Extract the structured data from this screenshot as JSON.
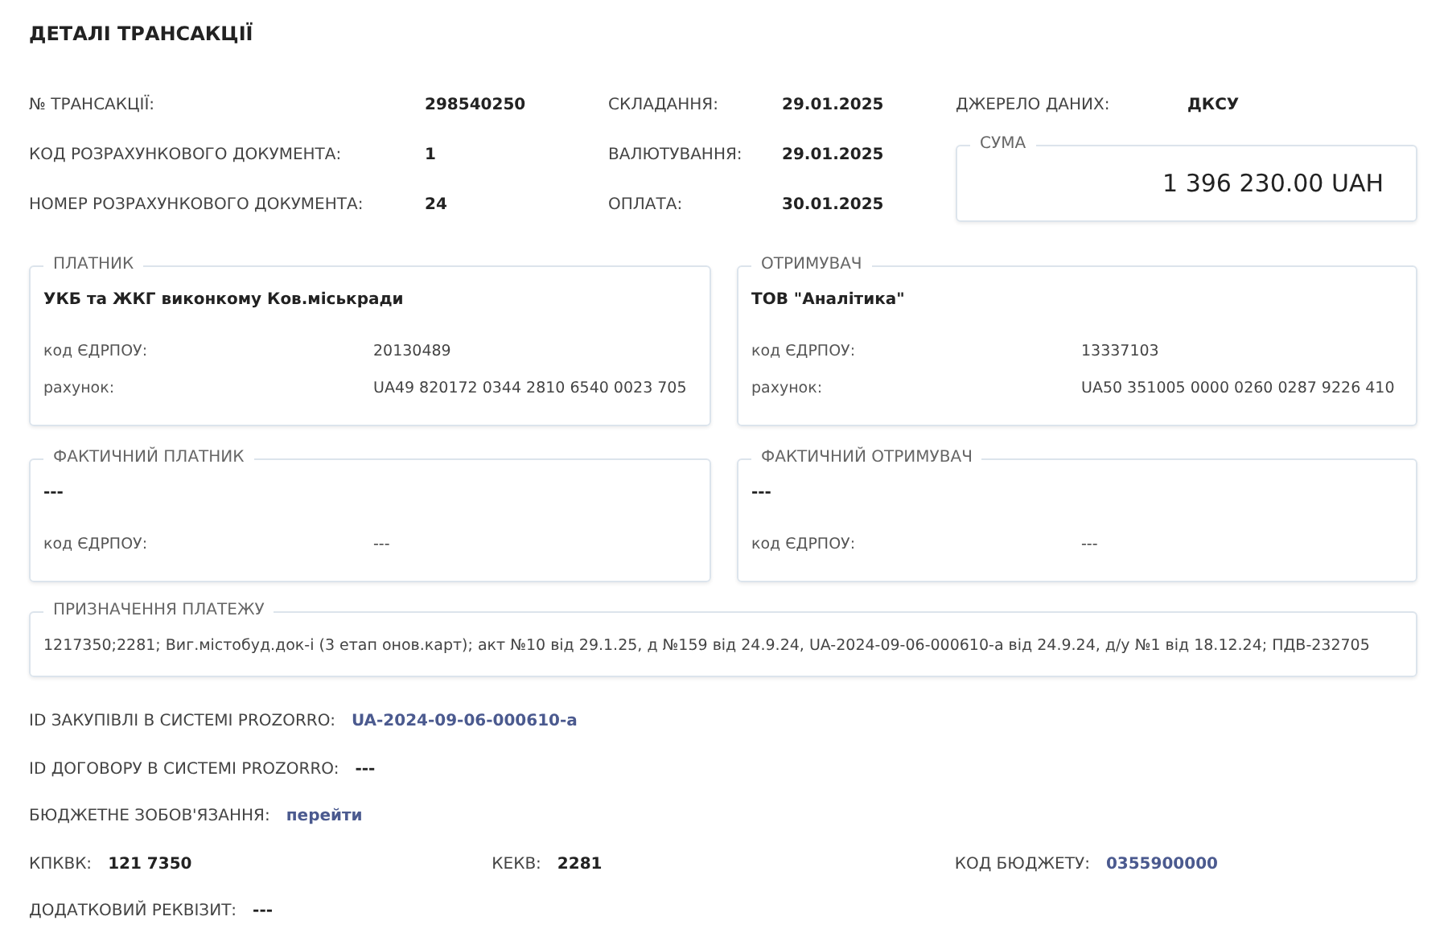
{
  "title": "ДЕТАЛІ ТРАНСАКЦІЇ",
  "fields": [
    {
      "label": "№ ТРАНСАКЦІЇ:",
      "value": "298540250"
    },
    {
      "label": "СКЛАДАННЯ:",
      "value": "29.01.2025"
    },
    {
      "label": "ДЖЕРЕЛО ДАНИХ:",
      "value": "ДКСУ"
    },
    {
      "label": "КОД РОЗРАХУНКОВОГО ДОКУМЕНТА:",
      "value": "1"
    },
    {
      "label": "ВАЛЮТУВАННЯ:",
      "value": "29.01.2025"
    },
    {
      "label": "НОМЕР РОЗРАХУНКОВОГО ДОКУМЕНТА:",
      "value": "24"
    },
    {
      "label": "ОПЛАТА:",
      "value": "30.01.2025"
    }
  ],
  "sum": {
    "title": "СУМА",
    "value": "1 396 230.00 UAH"
  },
  "parties": [
    {
      "title": "ПЛАТНИК",
      "name": "УКБ та ЖКГ виконкому Ков.міськради",
      "fields": [
        {
          "label": "код ЄДРПОУ:",
          "value": "20130489"
        },
        {
          "label": "рахунок:",
          "value": "UA49 820172 0344 2810 6540 0023 705"
        }
      ]
    },
    {
      "title": "ОТРИМУВАЧ",
      "name": "ТОВ \"Аналітика\"",
      "fields": [
        {
          "label": "код ЄДРПОУ:",
          "value": "13337103"
        },
        {
          "label": "рахунок:",
          "value": "UA50 351005 0000 0260 0287 9226 410"
        }
      ]
    },
    {
      "title": "ФАКТИЧНИЙ ПЛАТНИК",
      "name": "---",
      "fields": [
        {
          "label": "код ЄДРПОУ:",
          "value": "---"
        }
      ]
    },
    {
      "title": "ФАКТИЧНИЙ ОТРИМУВАЧ",
      "name": "---",
      "fields": [
        {
          "label": "код ЄДРПОУ:",
          "value": "---"
        }
      ]
    }
  ],
  "purpose": {
    "title": "ПРИЗНАЧЕННЯ ПЛАТЕЖУ",
    "text": "1217350;2281; Виг.містобуд.док-і (3 етап онов.карт); акт №10 від 29.1.25, д №159 від 24.9.24, UA-2024-09-06-000610-a від 24.9.24, д/у №1 від 18.12.24; ПДВ-232705"
  },
  "extra": [
    [
      {
        "label": "ID ЗАКУПІВЛІ В СИСТЕМІ PROZORRO:",
        "value": "UA-2024-09-06-000610-a",
        "kind": "link"
      }
    ],
    [
      {
        "label": "ID ДОГОВОРУ В СИСТЕМІ PROZORRO:",
        "value": "---",
        "kind": "text"
      }
    ],
    [
      {
        "label": "БЮДЖЕТНЕ ЗОБОВ'ЯЗАННЯ:",
        "value": "перейти",
        "kind": "link"
      }
    ],
    [
      {
        "label": "КПКВК:",
        "value": "121 7350",
        "kind": "text"
      },
      {
        "label": "КЕКВ:",
        "value": "2281",
        "kind": "text"
      },
      {
        "label": "КОД БЮДЖЕТУ:",
        "value": "0355900000",
        "kind": "link"
      }
    ],
    [
      {
        "label": "ДОДАТКОВИЙ РЕКВІЗИТ:",
        "value": "---",
        "kind": "text"
      }
    ]
  ]
}
